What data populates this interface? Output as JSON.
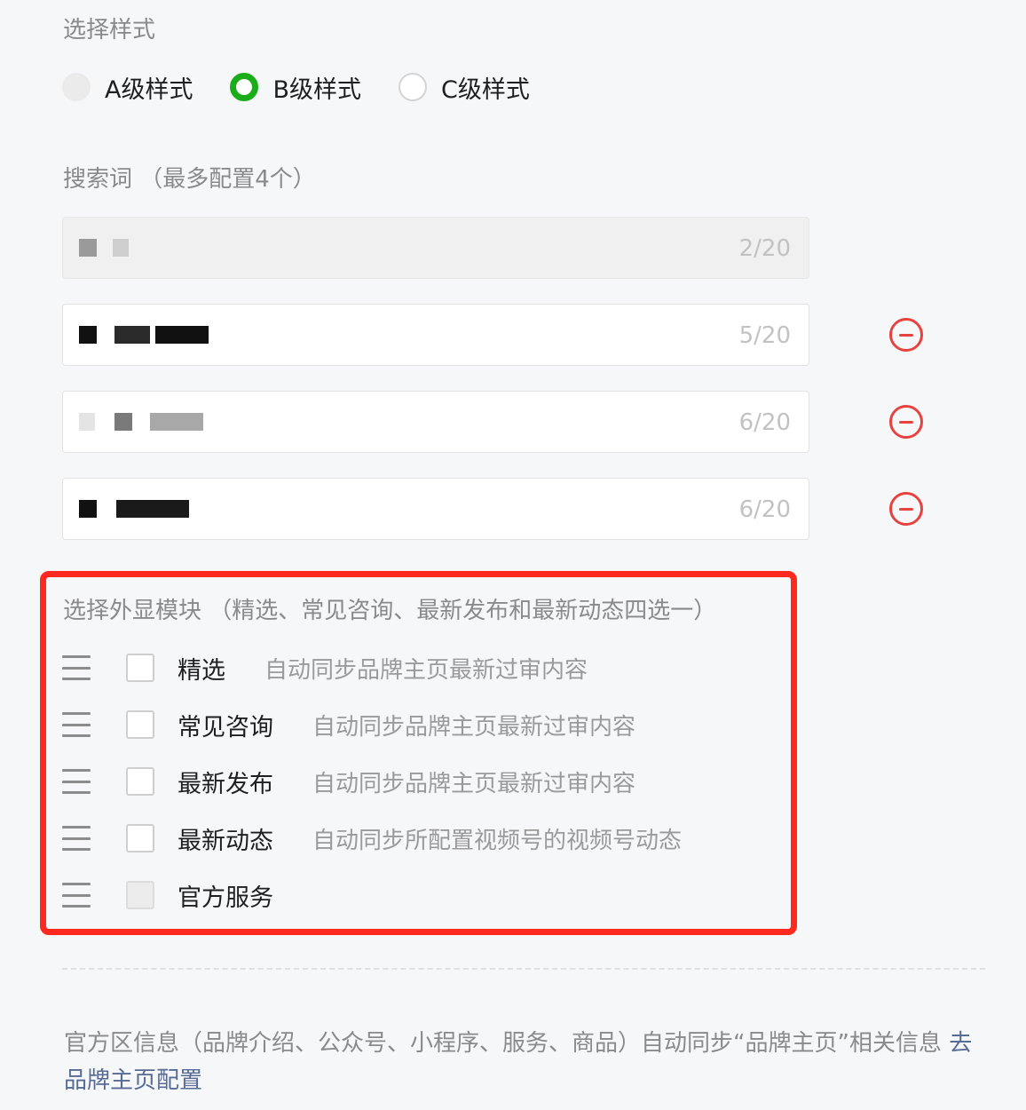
{
  "style_section": {
    "title": "选择样式",
    "options": [
      {
        "label": "A级样式",
        "state": "disabled"
      },
      {
        "label": "B级样式",
        "state": "checked"
      },
      {
        "label": "C级样式",
        "state": "unchecked"
      }
    ],
    "accent_color": "#1aad19"
  },
  "keywords_section": {
    "title": "搜索词 （最多配置4个）",
    "items": [
      {
        "count": "2/20",
        "readonly": true
      },
      {
        "count": "5/20",
        "readonly": false
      },
      {
        "count": "6/20",
        "readonly": false
      },
      {
        "count": "6/20",
        "readonly": false
      }
    ],
    "remove_icon_color": "#e64340"
  },
  "modules_section": {
    "title": "选择外显模块 （精选、常见咨询、最新发布和最新动态四选一）",
    "highlight_color": "#ff2a1f",
    "items": [
      {
        "name": "精选",
        "desc": "自动同步品牌主页最新过审内容",
        "checked": false,
        "disabled": false
      },
      {
        "name": "常见咨询",
        "desc": "自动同步品牌主页最新过审内容",
        "checked": false,
        "disabled": false
      },
      {
        "name": "最新发布",
        "desc": "自动同步品牌主页最新过审内容",
        "checked": false,
        "disabled": false
      },
      {
        "name": "最新动态",
        "desc": "自动同步所配置视频号的视频号动态",
        "checked": false,
        "disabled": false
      },
      {
        "name": "官方服务",
        "desc": "",
        "checked": false,
        "disabled": true
      }
    ]
  },
  "footer": {
    "text": "官方区信息（品牌介绍、公众号、小程序、服务、商品）自动同步“品牌主页”相关信息 ",
    "link_label": "去品牌主页配置",
    "link_color": "#576b95"
  }
}
